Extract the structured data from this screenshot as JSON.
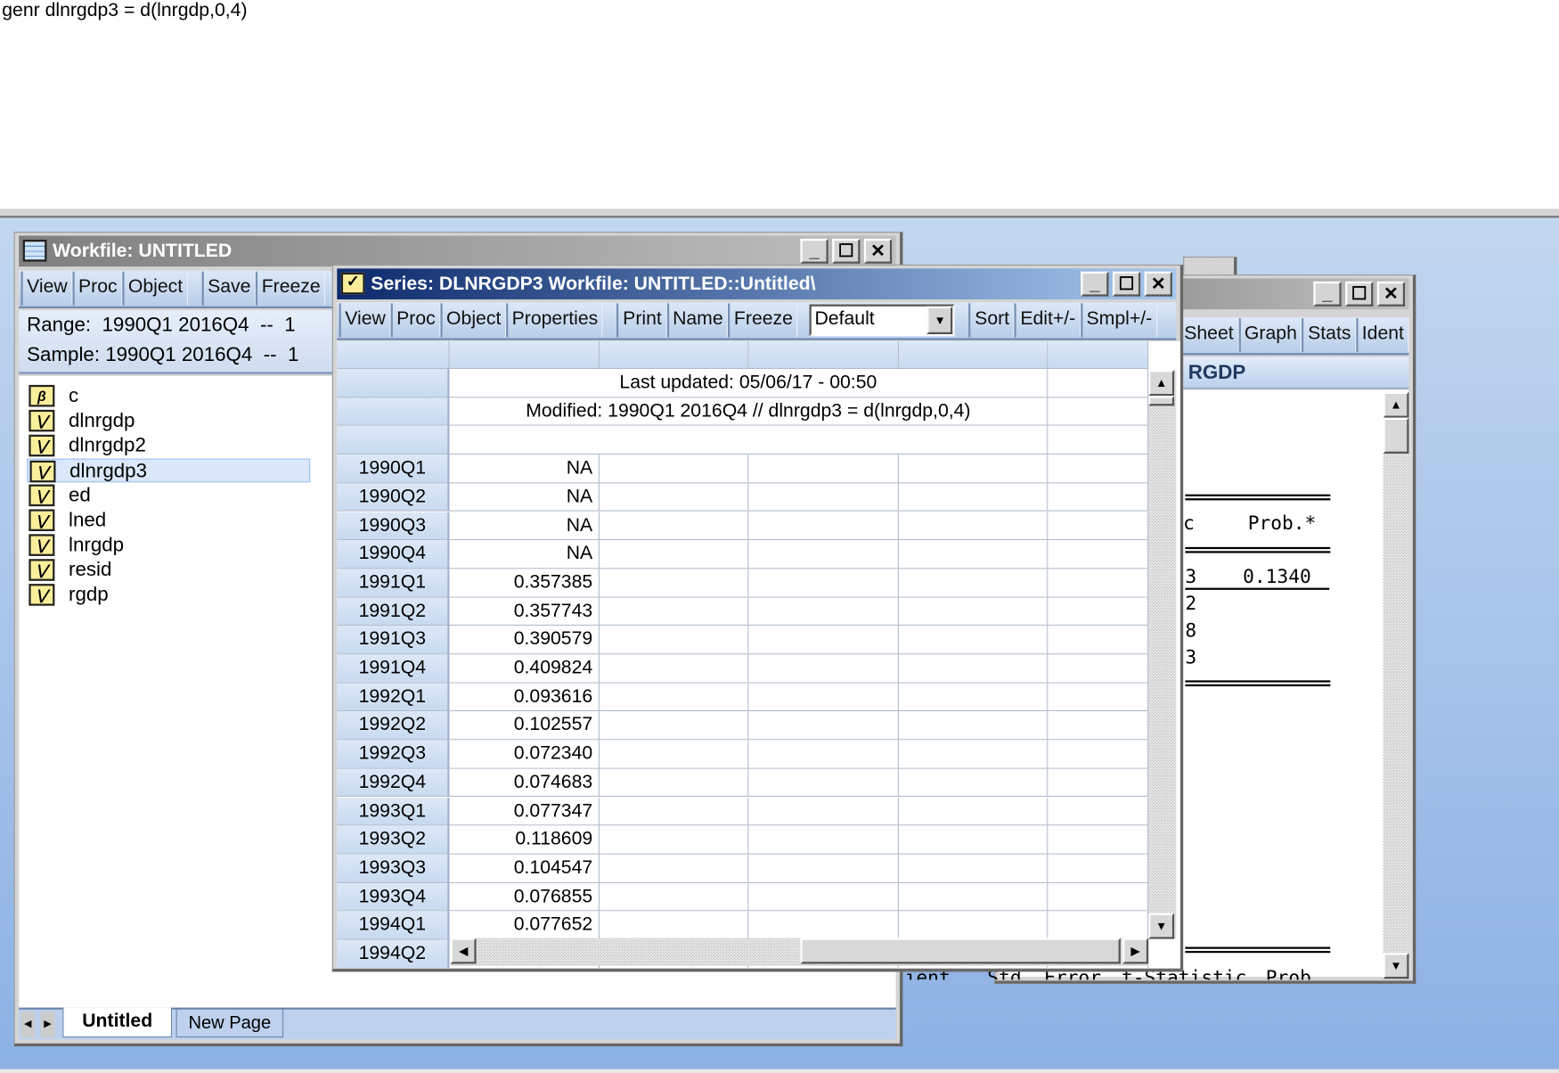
{
  "command": "genr dlnrgdp3 = d(lnrgdp,0,4)",
  "workfile": {
    "title": "Workfile: UNTITLED",
    "toolbar": [
      "View",
      "Proc",
      "Object",
      "Save",
      "Freeze"
    ],
    "range": "Range:  1990Q1 2016Q4  --  1",
    "sample": "Sample: 1990Q1 2016Q4  --  1",
    "objects": [
      {
        "name": "c",
        "icon": "coefficient-beta-icon"
      },
      {
        "name": "dlnrgdp",
        "icon": "series-icon"
      },
      {
        "name": "dlnrgdp2",
        "icon": "series-icon"
      },
      {
        "name": "dlnrgdp3",
        "icon": "series-icon",
        "selected": true
      },
      {
        "name": "ed",
        "icon": "series-icon"
      },
      {
        "name": "lned",
        "icon": "series-icon"
      },
      {
        "name": "lnrgdp",
        "icon": "series-icon"
      },
      {
        "name": "resid",
        "icon": "series-icon"
      },
      {
        "name": "rgdp",
        "icon": "series-icon"
      }
    ],
    "tabs": [
      {
        "label": "Untitled",
        "active": true
      },
      {
        "label": "New Page",
        "active": false
      }
    ]
  },
  "back_window": {
    "toolbar": [
      "Sheet",
      "Graph",
      "Stats",
      "Ident"
    ],
    "header": "RGDP",
    "col_head_fragment": "c",
    "prob_header": "Prob.*",
    "rows": [
      "3",
      "2",
      "8",
      "3"
    ],
    "prob_value": "0.1340",
    "bottom_headers": [
      "ient",
      "Std. Error",
      "t-Statistic",
      "Prob."
    ]
  },
  "series": {
    "title": "Series: DLNRGDP3   Workfile: UNTITLED::Untitled\\",
    "toolbar": [
      "View",
      "Proc",
      "Object",
      "Properties",
      "Print",
      "Name",
      "Freeze"
    ],
    "display_select": "Default",
    "toolbar2": [
      "Sort",
      "Edit+/-",
      "Smpl+/-"
    ],
    "last_updated": "Last updated: 05/06/17 - 00:50",
    "modified": "Modified: 1990Q1 2016Q4 // dlnrgdp3 = d(lnrgdp,0,4)",
    "rows": [
      {
        "obs": "1990Q1",
        "value": "NA"
      },
      {
        "obs": "1990Q2",
        "value": "NA"
      },
      {
        "obs": "1990Q3",
        "value": "NA"
      },
      {
        "obs": "1990Q4",
        "value": "NA"
      },
      {
        "obs": "1991Q1",
        "value": "0.357385"
      },
      {
        "obs": "1991Q2",
        "value": "0.357743"
      },
      {
        "obs": "1991Q3",
        "value": "0.390579"
      },
      {
        "obs": "1991Q4",
        "value": "0.409824"
      },
      {
        "obs": "1992Q1",
        "value": "0.093616"
      },
      {
        "obs": "1992Q2",
        "value": "0.102557"
      },
      {
        "obs": "1992Q3",
        "value": "0.072340"
      },
      {
        "obs": "1992Q4",
        "value": "0.074683"
      },
      {
        "obs": "1993Q1",
        "value": "0.077347"
      },
      {
        "obs": "1993Q2",
        "value": "0.118609"
      },
      {
        "obs": "1993Q3",
        "value": "0.104547"
      },
      {
        "obs": "1993Q4",
        "value": "0.076855"
      },
      {
        "obs": "1994Q1",
        "value": "0.077652"
      },
      {
        "obs": "1994Q2",
        "value": ""
      }
    ]
  },
  "colors": {
    "active_title": "#0c2a6c",
    "desktop": "#a8c4ea",
    "series_icon": "#fbee9a",
    "selection": "#dbe8fb"
  }
}
